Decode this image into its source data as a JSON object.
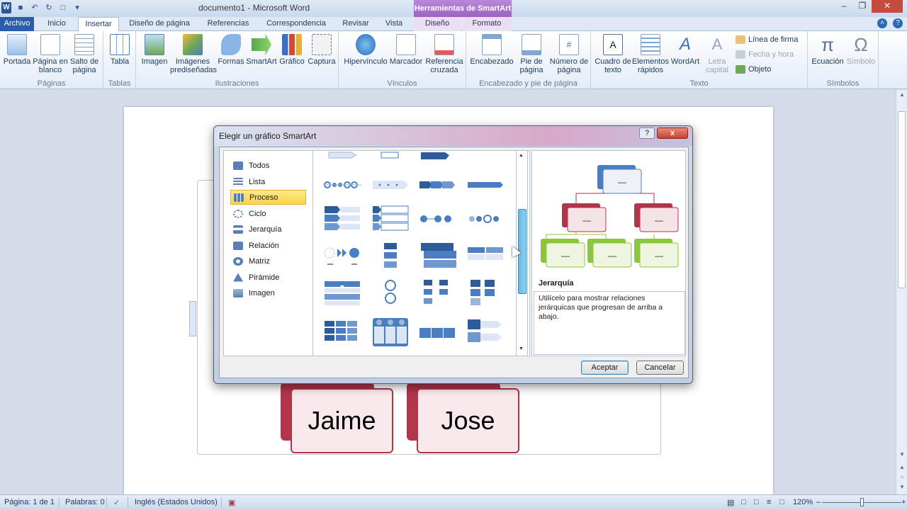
{
  "window": {
    "title": "documento1 - Microsoft Word",
    "contextual_tools": "Herramientas de SmartArt"
  },
  "tabs": [
    {
      "label": "Archivo"
    },
    {
      "label": "Inicio"
    },
    {
      "label": "Insertar"
    },
    {
      "label": "Diseño de página"
    },
    {
      "label": "Referencias"
    },
    {
      "label": "Correspondencia"
    },
    {
      "label": "Revisar"
    },
    {
      "label": "Vista"
    },
    {
      "label": "Diseño"
    },
    {
      "label": "Formato"
    }
  ],
  "ribbon": {
    "groups": {
      "paginas": "Páginas",
      "tablas": "Tablas",
      "ilustraciones": "Ilustraciones",
      "vinculos": "Vínculos",
      "encabezado": "Encabezado y pie de página",
      "texto": "Texto",
      "simbolos": "Símbolos"
    },
    "buttons": {
      "portada": "Portada",
      "pagina_blanco": "Página en blanco",
      "salto_pagina": "Salto de página",
      "tabla": "Tabla",
      "imagen": "Imagen",
      "imagenes_prediseñadas": "Imágenes prediseñadas",
      "formas": "Formas",
      "smartart": "SmartArt",
      "grafico": "Gráfico",
      "captura": "Captura",
      "hipervinculo": "Hipervínculo",
      "marcador": "Marcador",
      "referencia_cruzada": "Referencia cruzada",
      "encabezado": "Encabezado",
      "pie_pagina": "Pie de página",
      "numero_pagina": "Número de página",
      "cuadro_texto": "Cuadro de texto",
      "elementos_rapidos": "Elementos rápidos",
      "wordart": "WordArt",
      "letra_capital": "Letra capital",
      "linea_firma": "Línea de firma",
      "fecha_hora": "Fecha y hora",
      "objeto": "Objeto",
      "ecuacion": "Ecuación",
      "simbolo": "Símbolo"
    }
  },
  "document": {
    "nodes": [
      "Jaime",
      "Jose"
    ]
  },
  "dialog": {
    "title": "Elegir un gráfico SmartArt",
    "help": "?",
    "close": "x",
    "categories": [
      {
        "label": "Todos"
      },
      {
        "label": "Lista"
      },
      {
        "label": "Proceso"
      },
      {
        "label": "Ciclo"
      },
      {
        "label": "Jerarquía"
      },
      {
        "label": "Relación"
      },
      {
        "label": "Matriz"
      },
      {
        "label": "Pirámide"
      },
      {
        "label": "Imagen"
      }
    ],
    "selected_category": "Proceso",
    "preview": {
      "title": "Jerarquía",
      "description": "Utilícelo para mostrar relaciones jerárquicas que progresan de arriba a abajo.",
      "box_text": "—"
    },
    "accept": "Aceptar",
    "cancel": "Cancelar"
  },
  "statusbar": {
    "page": "Página: 1 de 1",
    "words": "Palabras: 0",
    "language": "Inglés (Estados Unidos)",
    "zoom": "120%"
  },
  "colors": {
    "accent_blue": "#2a5ea8",
    "smartart_purple": "#9d63c4",
    "node_red": "#b23549",
    "preview_blue": "#4a7ec2",
    "preview_green": "#8cc63f"
  }
}
